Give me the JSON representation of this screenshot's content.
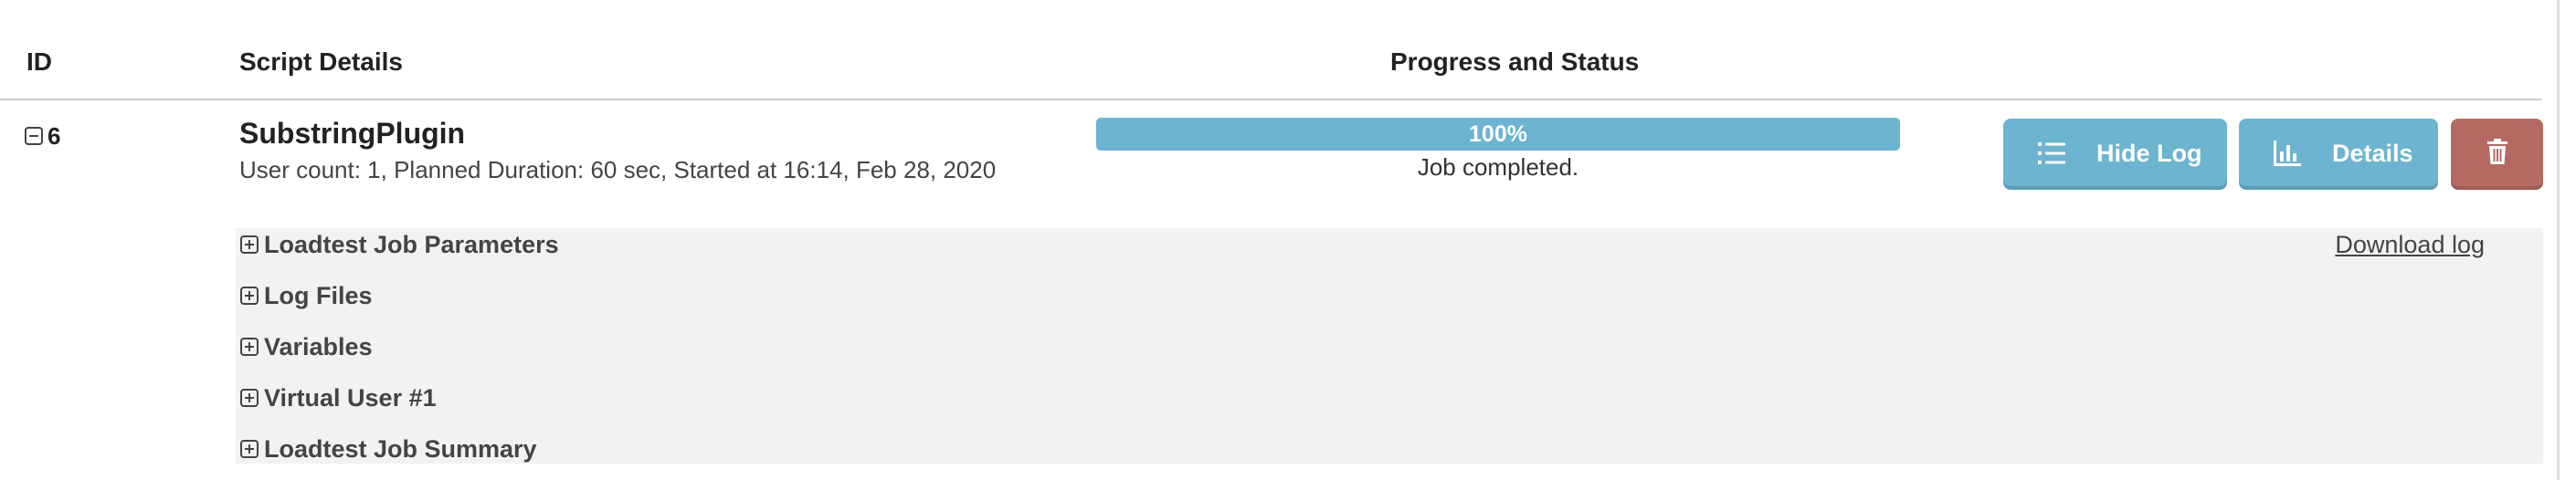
{
  "table": {
    "headers": {
      "id": "ID",
      "script_details": "Script Details",
      "progress_status": "Progress and Status"
    }
  },
  "job": {
    "id": "6",
    "script_name": "SubstringPlugin",
    "summary": "User count: 1, Planned Duration: 60 sec, Started at 16:14, Feb 28, 2020",
    "progress_percent": 100,
    "progress_label": "100%",
    "status_text": "Job completed.",
    "expanded": true
  },
  "actions": {
    "hide_log_label": "Hide Log",
    "hide_log_icon": "list-icon",
    "details_label": "Details",
    "details_icon": "bar-chart-icon",
    "delete_icon": "trash-icon"
  },
  "log_panel": {
    "download_label": "Download log",
    "sections": [
      {
        "label": "Loadtest Job Parameters"
      },
      {
        "label": "Log Files"
      },
      {
        "label": "Variables"
      },
      {
        "label": "Virtual User #1"
      },
      {
        "label": "Loadtest Job Summary"
      }
    ]
  },
  "colors": {
    "primary_button": "#6cb4cf",
    "danger_button": "#b46a63",
    "panel_background": "#f2f2f2"
  }
}
